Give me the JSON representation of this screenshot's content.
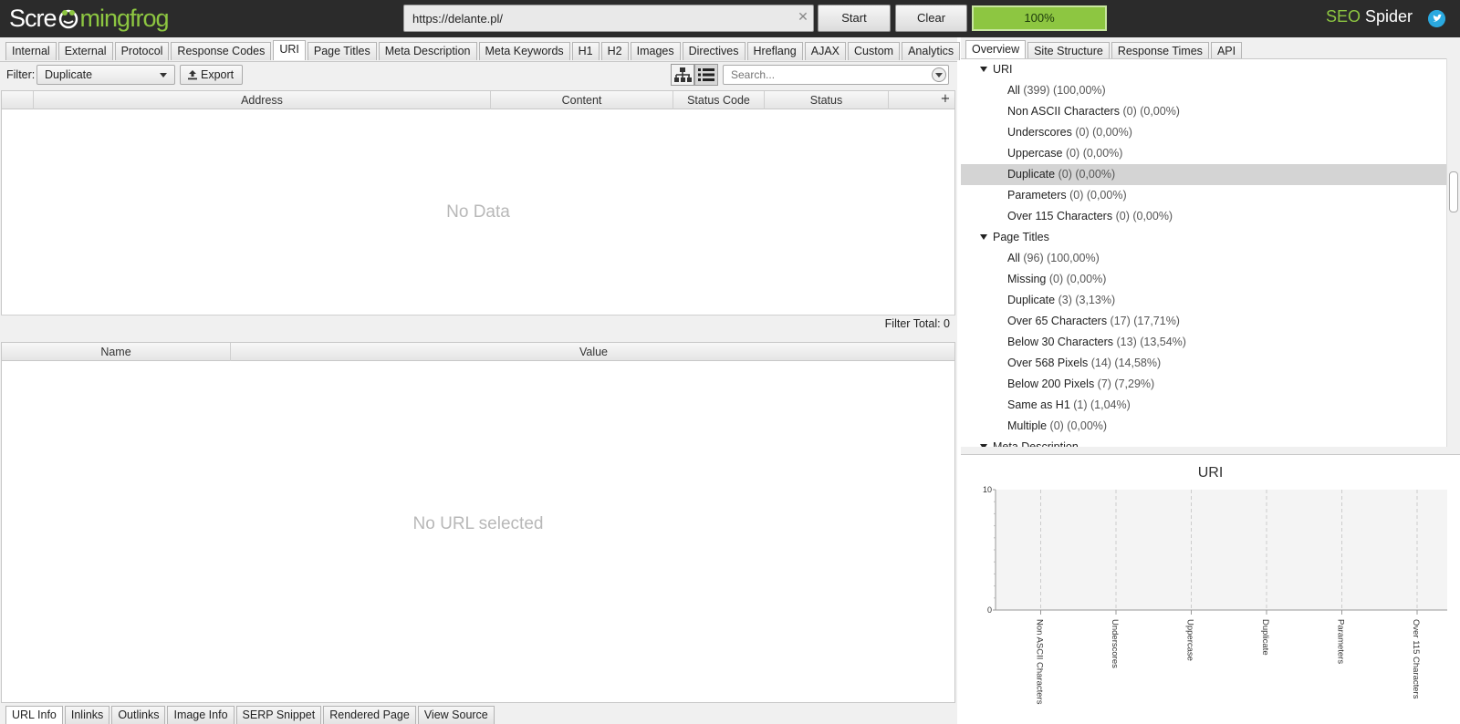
{
  "topbar": {
    "logo_pre": "Scre",
    "logo_post": "mingfrog",
    "url_value": "https://delante.pl/",
    "start_label": "Start",
    "clear_label": "Clear",
    "progress_label": "100%",
    "progress_value": 1.0,
    "brand_seo": "SEO",
    "brand_spider": " Spider"
  },
  "left": {
    "tabs": [
      {
        "label": "Internal",
        "active": false
      },
      {
        "label": "External",
        "active": false
      },
      {
        "label": "Protocol",
        "active": false
      },
      {
        "label": "Response Codes",
        "active": false
      },
      {
        "label": "URI",
        "active": true
      },
      {
        "label": "Page Titles",
        "active": false
      },
      {
        "label": "Meta Description",
        "active": false
      },
      {
        "label": "Meta Keywords",
        "active": false
      },
      {
        "label": "H1",
        "active": false
      },
      {
        "label": "H2",
        "active": false
      },
      {
        "label": "Images",
        "active": false
      },
      {
        "label": "Directives",
        "active": false
      },
      {
        "label": "Hreflang",
        "active": false
      },
      {
        "label": "AJAX",
        "active": false
      },
      {
        "label": "Custom",
        "active": false
      },
      {
        "label": "Analytics",
        "active": false
      }
    ],
    "filter_label": "Filter:",
    "filter_value": "Duplicate",
    "export_label": "Export",
    "search_placeholder": "Search...",
    "columns": [
      "Address",
      "Content",
      "Status Code",
      "Status"
    ],
    "no_data": "No Data",
    "filter_total": "Filter Total:  0",
    "detail_columns": [
      "Name",
      "Value"
    ],
    "no_url": "No URL selected",
    "bottom_tabs": [
      {
        "label": "URL Info",
        "active": true
      },
      {
        "label": "Inlinks",
        "active": false
      },
      {
        "label": "Outlinks",
        "active": false
      },
      {
        "label": "Image Info",
        "active": false
      },
      {
        "label": "SERP Snippet",
        "active": false
      },
      {
        "label": "Rendered Page",
        "active": false
      },
      {
        "label": "View Source",
        "active": false
      }
    ]
  },
  "right": {
    "tabs": [
      {
        "label": "Overview",
        "active": true
      },
      {
        "label": "Site Structure",
        "active": false
      },
      {
        "label": "Response Times",
        "active": false
      },
      {
        "label": "API",
        "active": false
      }
    ],
    "tree": [
      {
        "kind": "header",
        "label": "URI"
      },
      {
        "kind": "child",
        "label": "All",
        "count": "(399) (100,00%)"
      },
      {
        "kind": "child",
        "label": "Non ASCII Characters",
        "count": "(0) (0,00%)"
      },
      {
        "kind": "child",
        "label": "Underscores",
        "count": "(0) (0,00%)"
      },
      {
        "kind": "child",
        "label": "Uppercase",
        "count": "(0) (0,00%)"
      },
      {
        "kind": "child",
        "label": "Duplicate",
        "count": "(0) (0,00%)",
        "selected": true
      },
      {
        "kind": "child",
        "label": "Parameters",
        "count": "(0) (0,00%)"
      },
      {
        "kind": "child",
        "label": "Over 115 Characters",
        "count": "(0) (0,00%)"
      },
      {
        "kind": "header",
        "label": "Page Titles"
      },
      {
        "kind": "child",
        "label": "All",
        "count": "(96) (100,00%)"
      },
      {
        "kind": "child",
        "label": "Missing",
        "count": "(0) (0,00%)"
      },
      {
        "kind": "child",
        "label": "Duplicate",
        "count": "(3) (3,13%)"
      },
      {
        "kind": "child",
        "label": "Over 65 Characters",
        "count": "(17) (17,71%)"
      },
      {
        "kind": "child",
        "label": "Below 30 Characters",
        "count": "(13) (13,54%)"
      },
      {
        "kind": "child",
        "label": "Over 568 Pixels",
        "count": "(14) (14,58%)"
      },
      {
        "kind": "child",
        "label": "Below 200 Pixels",
        "count": "(7) (7,29%)"
      },
      {
        "kind": "child",
        "label": "Same as H1",
        "count": "(1) (1,04%)"
      },
      {
        "kind": "child",
        "label": "Multiple",
        "count": "(0) (0,00%)"
      },
      {
        "kind": "header",
        "label": "Meta Description"
      }
    ],
    "chart_data": {
      "type": "bar",
      "title": "URI",
      "categories": [
        "Non ASCII Characters",
        "Underscores",
        "Uppercase",
        "Duplicate",
        "Parameters",
        "Over 115 Characters"
      ],
      "values": [
        0,
        0,
        0,
        0,
        0,
        0
      ],
      "ylim": [
        0,
        10
      ],
      "yticks": [
        "0",
        "10"
      ],
      "xlabel": "",
      "ylabel": "",
      "grid": true
    }
  }
}
